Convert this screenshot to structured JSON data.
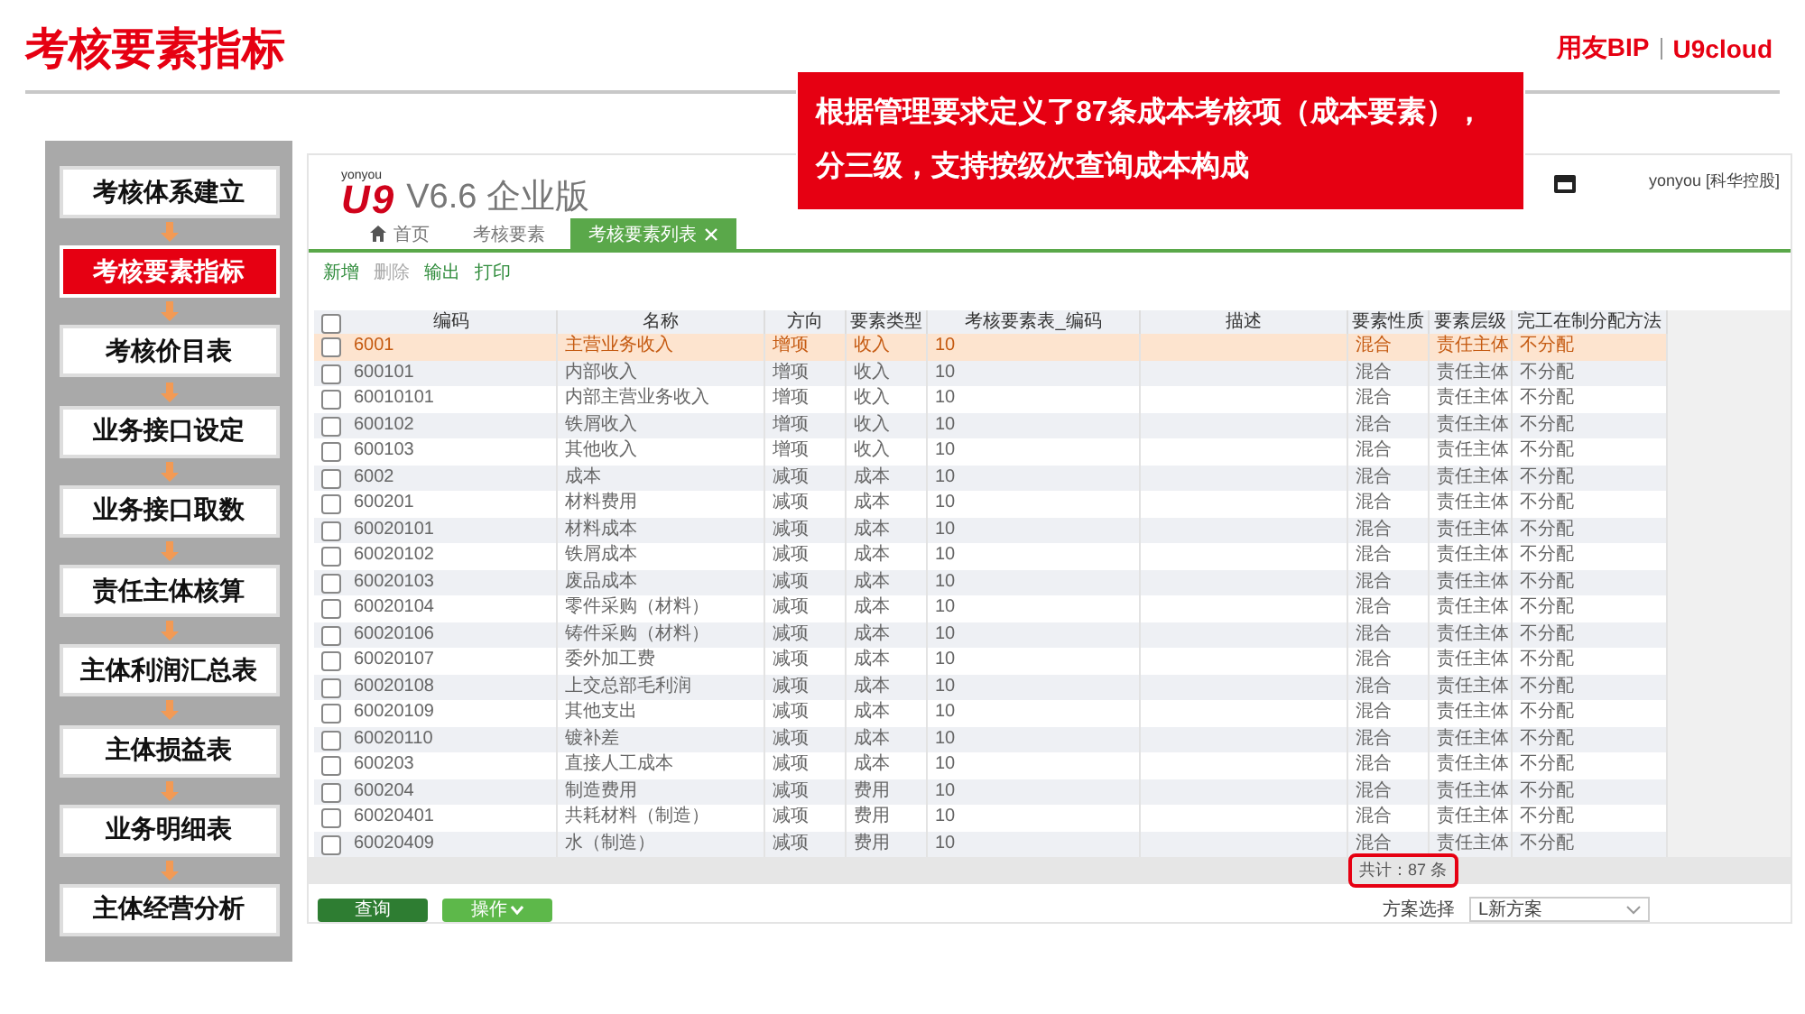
{
  "slide_title": "考核要素指标",
  "brand": {
    "name": "用友BIP",
    "product": "U9cloud"
  },
  "steps": [
    {
      "label": "考核体系建立",
      "selected": false
    },
    {
      "label": "考核要素指标",
      "selected": true
    },
    {
      "label": "考核价目表",
      "selected": false
    },
    {
      "label": "业务接口设定",
      "selected": false
    },
    {
      "label": "业务接口取数",
      "selected": false
    },
    {
      "label": "责任主体核算",
      "selected": false
    },
    {
      "label": "主体利润汇总表",
      "selected": false
    },
    {
      "label": "主体损益表",
      "selected": false
    },
    {
      "label": "业务明细表",
      "selected": false
    },
    {
      "label": "主体经营分析",
      "selected": false
    }
  ],
  "callout": "根据管理要求定义了87条成本考核项（成本要素），分三级，支持按级次查询成本构成",
  "app": {
    "vendor": "yonyou",
    "mark": "U9",
    "version": "V6.6 企业版",
    "user": "yonyou [科华控股]",
    "tabs": [
      {
        "label": "首页",
        "selected": false,
        "kind": "home"
      },
      {
        "label": "考核要素",
        "selected": false,
        "kind": "plain"
      },
      {
        "label": "考核要素列表",
        "selected": true,
        "kind": "closable"
      }
    ],
    "toolbar": [
      {
        "label": "新增",
        "disabled": false
      },
      {
        "label": "删除",
        "disabled": true
      },
      {
        "label": "输出",
        "disabled": false
      },
      {
        "label": "打印",
        "disabled": false
      }
    ],
    "table": {
      "select_all_checked": false,
      "columns": [
        "编码",
        "名称",
        "方向",
        "要素类型",
        "考核要素表_编码",
        "描述",
        "要素性质",
        "要素层级",
        "完工在制分配方法"
      ],
      "rows": [
        {
          "cells": [
            "6001",
            "主营业务收入",
            "增项",
            "收入",
            "10",
            "",
            "混合",
            "责任主体",
            "不分配"
          ],
          "selected": true,
          "checked": false
        },
        {
          "cells": [
            "600101",
            "内部收入",
            "增项",
            "收入",
            "10",
            "",
            "混合",
            "责任主体",
            "不分配"
          ],
          "selected": false,
          "checked": false
        },
        {
          "cells": [
            "60010101",
            "内部主营业务收入",
            "增项",
            "收入",
            "10",
            "",
            "混合",
            "责任主体",
            "不分配"
          ],
          "selected": false,
          "checked": false
        },
        {
          "cells": [
            "600102",
            "铁屑收入",
            "增项",
            "收入",
            "10",
            "",
            "混合",
            "责任主体",
            "不分配"
          ],
          "selected": false,
          "checked": false
        },
        {
          "cells": [
            "600103",
            "其他收入",
            "增项",
            "收入",
            "10",
            "",
            "混合",
            "责任主体",
            "不分配"
          ],
          "selected": false,
          "checked": false
        },
        {
          "cells": [
            "6002",
            "成本",
            "减项",
            "成本",
            "10",
            "",
            "混合",
            "责任主体",
            "不分配"
          ],
          "selected": false,
          "checked": false
        },
        {
          "cells": [
            "600201",
            "材料费用",
            "减项",
            "成本",
            "10",
            "",
            "混合",
            "责任主体",
            "不分配"
          ],
          "selected": false,
          "checked": false
        },
        {
          "cells": [
            "60020101",
            "材料成本",
            "减项",
            "成本",
            "10",
            "",
            "混合",
            "责任主体",
            "不分配"
          ],
          "selected": false,
          "checked": false
        },
        {
          "cells": [
            "60020102",
            "铁屑成本",
            "减项",
            "成本",
            "10",
            "",
            "混合",
            "责任主体",
            "不分配"
          ],
          "selected": false,
          "checked": false
        },
        {
          "cells": [
            "60020103",
            "废品成本",
            "减项",
            "成本",
            "10",
            "",
            "混合",
            "责任主体",
            "不分配"
          ],
          "selected": false,
          "checked": false
        },
        {
          "cells": [
            "60020104",
            "零件采购（材料）",
            "减项",
            "成本",
            "10",
            "",
            "混合",
            "责任主体",
            "不分配"
          ],
          "selected": false,
          "checked": false
        },
        {
          "cells": [
            "60020106",
            "铸件采购（材料）",
            "减项",
            "成本",
            "10",
            "",
            "混合",
            "责任主体",
            "不分配"
          ],
          "selected": false,
          "checked": false
        },
        {
          "cells": [
            "60020107",
            "委外加工费",
            "减项",
            "成本",
            "10",
            "",
            "混合",
            "责任主体",
            "不分配"
          ],
          "selected": false,
          "checked": false
        },
        {
          "cells": [
            "60020108",
            "上交总部毛利润",
            "减项",
            "成本",
            "10",
            "",
            "混合",
            "责任主体",
            "不分配"
          ],
          "selected": false,
          "checked": false
        },
        {
          "cells": [
            "60020109",
            "其他支出",
            "减项",
            "成本",
            "10",
            "",
            "混合",
            "责任主体",
            "不分配"
          ],
          "selected": false,
          "checked": false
        },
        {
          "cells": [
            "60020110",
            "镀补差",
            "减项",
            "成本",
            "10",
            "",
            "混合",
            "责任主体",
            "不分配"
          ],
          "selected": false,
          "checked": false
        },
        {
          "cells": [
            "600203",
            "直接人工成本",
            "减项",
            "成本",
            "10",
            "",
            "混合",
            "责任主体",
            "不分配"
          ],
          "selected": false,
          "checked": false
        },
        {
          "cells": [
            "600204",
            "制造费用",
            "减项",
            "费用",
            "10",
            "",
            "混合",
            "责任主体",
            "不分配"
          ],
          "selected": false,
          "checked": false
        },
        {
          "cells": [
            "60020401",
            "共耗材料（制造）",
            "减项",
            "费用",
            "10",
            "",
            "混合",
            "责任主体",
            "不分配"
          ],
          "selected": false,
          "checked": false
        },
        {
          "cells": [
            "60020409",
            "水（制造）",
            "减项",
            "费用",
            "10",
            "",
            "混合",
            "责任主体",
            "不分配"
          ],
          "selected": false,
          "checked": false
        }
      ],
      "total": "共计：87 条"
    },
    "buttons": [
      {
        "label": "查询",
        "kind": "plain"
      },
      {
        "label": "操作",
        "kind": "menu"
      }
    ],
    "scheme_label": "方案选择",
    "scheme_value": "L新方案"
  }
}
